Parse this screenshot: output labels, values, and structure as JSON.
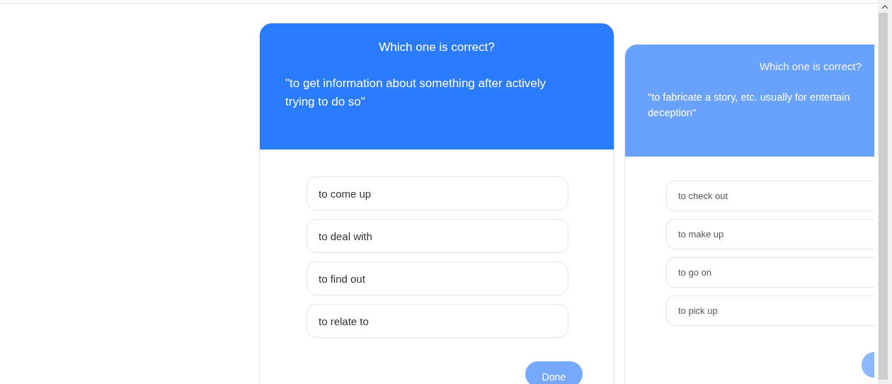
{
  "cards": [
    {
      "kind": "current",
      "title": "Which one is correct?",
      "definition": "\"to get information about something after actively trying to do so\"",
      "options": [
        {
          "label": "to come up"
        },
        {
          "label": "to deal with"
        },
        {
          "label": "to find out"
        },
        {
          "label": "to relate to"
        }
      ],
      "done_button": {
        "label": "Done"
      }
    },
    {
      "kind": "upcoming",
      "title": "Which one is correct?",
      "definition": "\"to fabricate a story, etc. usually for entertain deception\"",
      "options": [
        {
          "label": "to check out"
        },
        {
          "label": "to make up"
        },
        {
          "label": "to go on"
        },
        {
          "label": "to pick up"
        }
      ]
    }
  ]
}
